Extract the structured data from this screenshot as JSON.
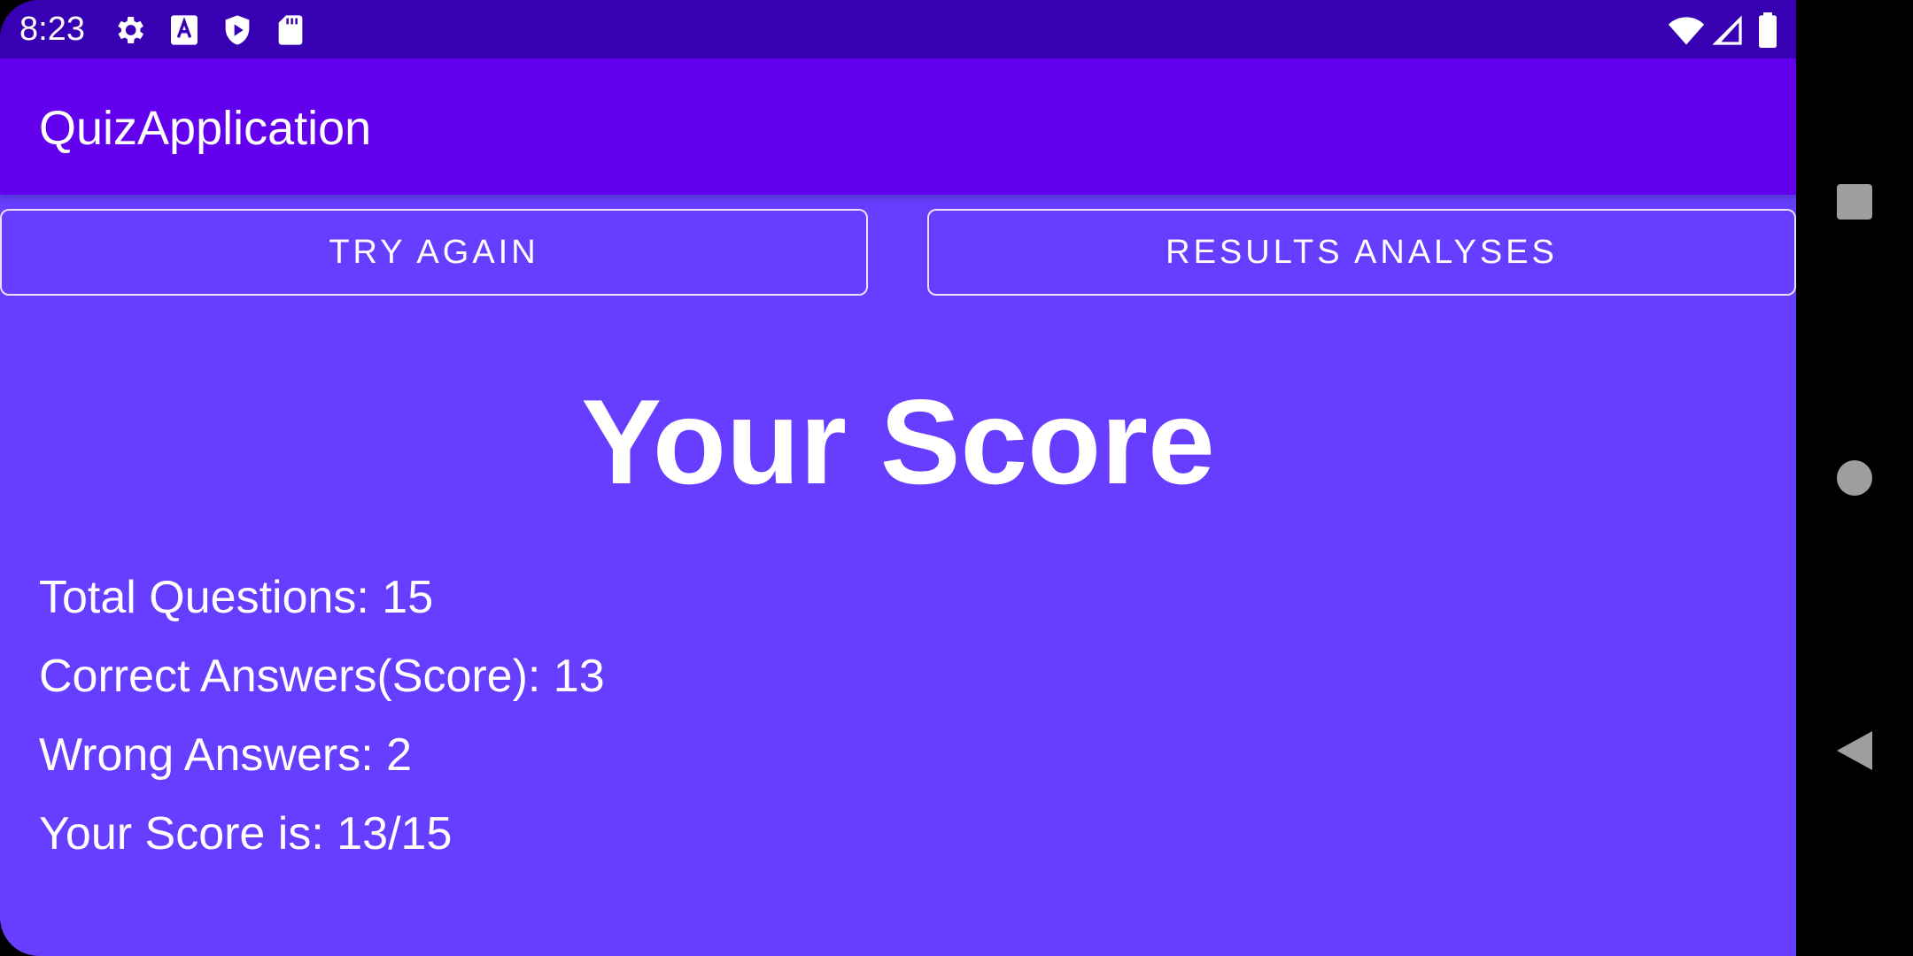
{
  "status_bar": {
    "time": "8:23",
    "left_icons": [
      "settings-icon",
      "font-a-icon",
      "play-protect-icon",
      "sd-card-icon"
    ],
    "right_icons": [
      "wifi-icon",
      "signal-icon",
      "battery-icon"
    ],
    "color": "#3700B3"
  },
  "app_bar": {
    "title": "QuizApplication",
    "color": "#6200EE"
  },
  "buttons": {
    "try_again": "TRY AGAIN",
    "results_analyses": "RESULTS ANALYSES"
  },
  "main": {
    "heading": "Your Score",
    "background": "#673EFF",
    "stats": [
      "Total Questions: 15",
      "Correct Answers(Score): 13",
      "Wrong Answers: 2",
      "Your Score is: 13/15"
    ]
  },
  "nav_bar": {
    "icons": [
      "recents-square-icon",
      "home-circle-icon",
      "back-triangle-icon"
    ]
  }
}
